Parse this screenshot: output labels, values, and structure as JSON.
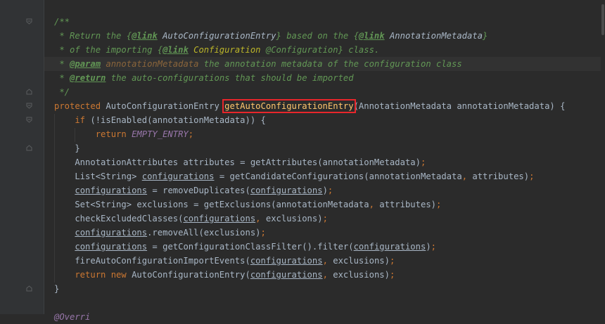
{
  "editor": {
    "highlight_color": "#e8262b",
    "lines": [
      {
        "parts": [
          {
            "t": "/**",
            "c": "c-doc"
          }
        ]
      },
      {
        "parts": [
          {
            "t": " * Return the {",
            "c": "c-doc"
          },
          {
            "t": "@link",
            "c": "c-tag"
          },
          {
            "t": " AutoConfigurationEntry",
            "c": "c-link"
          },
          {
            "t": "} based on the {",
            "c": "c-doc"
          },
          {
            "t": "@link",
            "c": "c-tag"
          },
          {
            "t": " AnnotationMetadata",
            "c": "c-link"
          },
          {
            "t": "}",
            "c": "c-doc"
          }
        ]
      },
      {
        "parts": [
          {
            "t": " * of the importing {",
            "c": "c-doc"
          },
          {
            "t": "@link",
            "c": "c-tag"
          },
          {
            "t": " Configuration",
            "c": "c-link-y"
          },
          {
            "t": " @Configuration} class.",
            "c": "c-doc"
          }
        ]
      },
      {
        "parts": [
          {
            "t": " * ",
            "c": "c-doc"
          },
          {
            "t": "@param",
            "c": "c-tag"
          },
          {
            "t": " annotationMetadata",
            "c": "c-param"
          },
          {
            "t": " the annotation metadata of the configuration class",
            "c": "c-doc"
          }
        ]
      },
      {
        "parts": [
          {
            "t": " * ",
            "c": "c-doc"
          },
          {
            "t": "@return",
            "c": "c-tag"
          },
          {
            "t": " the auto-configurations that should be imported",
            "c": "c-doc"
          }
        ]
      },
      {
        "parts": [
          {
            "t": " */",
            "c": "c-doc"
          }
        ]
      },
      {
        "parts": [
          {
            "t": "protected ",
            "c": "kw"
          },
          {
            "t": "AutoConfigurationEntry ",
            "c": ""
          },
          {
            "t": "getAutoConfigurationEntry",
            "c": "fn box"
          },
          {
            "t": "(AnnotationMetadata annotationMetadata) {",
            "c": ""
          }
        ]
      },
      {
        "parts": [
          {
            "t": "    if ",
            "c": "kw"
          },
          {
            "t": "(!isEnabled(annotationMetadata)) {",
            "c": ""
          }
        ]
      },
      {
        "parts": [
          {
            "t": "        return ",
            "c": "kw"
          },
          {
            "t": "EMPTY_ENTRY",
            "c": "cst"
          },
          {
            "t": ";",
            "c": "kw"
          }
        ]
      },
      {
        "parts": [
          {
            "t": "    }",
            "c": ""
          }
        ]
      },
      {
        "parts": [
          {
            "t": "    AnnotationAttributes attributes = getAttributes(annotationMetadata)",
            "c": ""
          },
          {
            "t": ";",
            "c": "kw"
          }
        ]
      },
      {
        "parts": [
          {
            "t": "    List<String> ",
            "c": ""
          },
          {
            "t": "configurations",
            "c": "ul"
          },
          {
            "t": " = getCandidateConfigurations(annotationMetadata",
            "c": ""
          },
          {
            "t": ", ",
            "c": "kw"
          },
          {
            "t": "attributes)",
            "c": ""
          },
          {
            "t": ";",
            "c": "kw"
          }
        ]
      },
      {
        "parts": [
          {
            "t": "    ",
            "c": ""
          },
          {
            "t": "configurations",
            "c": "ul"
          },
          {
            "t": " = removeDuplicates(",
            "c": ""
          },
          {
            "t": "configurations",
            "c": "ul"
          },
          {
            "t": ")",
            "c": ""
          },
          {
            "t": ";",
            "c": "kw"
          }
        ]
      },
      {
        "parts": [
          {
            "t": "    Set<String> exclusions = getExclusions(annotationMetadata",
            "c": ""
          },
          {
            "t": ", ",
            "c": "kw"
          },
          {
            "t": "attributes)",
            "c": ""
          },
          {
            "t": ";",
            "c": "kw"
          }
        ]
      },
      {
        "parts": [
          {
            "t": "    checkExcludedClasses(",
            "c": ""
          },
          {
            "t": "configurations",
            "c": "ul"
          },
          {
            "t": ", ",
            "c": "kw"
          },
          {
            "t": "exclusions)",
            "c": ""
          },
          {
            "t": ";",
            "c": "kw"
          }
        ]
      },
      {
        "parts": [
          {
            "t": "    ",
            "c": ""
          },
          {
            "t": "configurations",
            "c": "ul"
          },
          {
            "t": ".removeAll(exclusions)",
            "c": ""
          },
          {
            "t": ";",
            "c": "kw"
          }
        ]
      },
      {
        "parts": [
          {
            "t": "    ",
            "c": ""
          },
          {
            "t": "configurations",
            "c": "ul"
          },
          {
            "t": " = getConfigurationClassFilter().filter(",
            "c": ""
          },
          {
            "t": "configurations",
            "c": "ul"
          },
          {
            "t": ")",
            "c": ""
          },
          {
            "t": ";",
            "c": "kw"
          }
        ]
      },
      {
        "parts": [
          {
            "t": "    fireAutoConfigurationImportEvents(",
            "c": ""
          },
          {
            "t": "configurations",
            "c": "ul"
          },
          {
            "t": ", ",
            "c": "kw"
          },
          {
            "t": "exclusions)",
            "c": ""
          },
          {
            "t": ";",
            "c": "kw"
          }
        ]
      },
      {
        "parts": [
          {
            "t": "    return new ",
            "c": "kw"
          },
          {
            "t": "AutoConfigurationEntry(",
            "c": ""
          },
          {
            "t": "configurations",
            "c": "ul"
          },
          {
            "t": ", ",
            "c": "kw"
          },
          {
            "t": "exclusions)",
            "c": ""
          },
          {
            "t": ";",
            "c": "kw"
          }
        ]
      },
      {
        "parts": [
          {
            "t": "}",
            "c": ""
          }
        ]
      },
      {
        "parts": []
      },
      {
        "parts": [
          {
            "t": "@Overri",
            "c": "cst"
          }
        ]
      }
    ]
  }
}
